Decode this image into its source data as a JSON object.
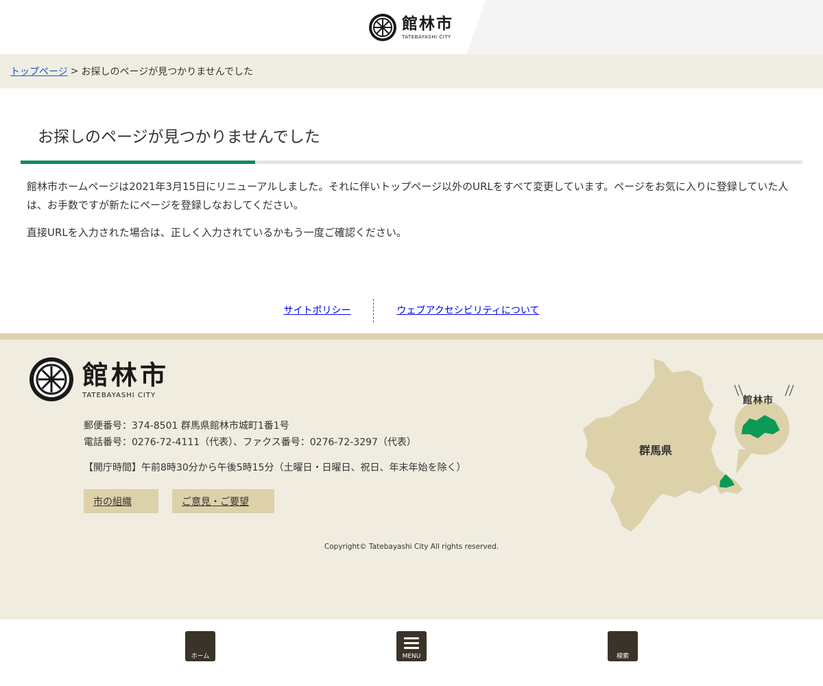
{
  "header": {
    "logo_name": "館林市",
    "logo_roman": "TATEBAYASHI CITY"
  },
  "breadcrumb": {
    "home": "トップページ",
    "separator": ">",
    "current": "お探しのページが見つかりませんでした"
  },
  "main": {
    "title": "お探しのページが見つかりませんでした",
    "paragraph1": "館林市ホームページは2021年3月15日にリニューアルしました。それに伴いトップページ以外のURLをすべて変更しています。ページをお気に入りに登録していた人は、お手数ですが新たにページを登録しなおしてください。",
    "paragraph2": "直接URLを入力された場合は、正しく入力されているかもう一度ご確認ください。",
    "accent_color": "#0e8a5a"
  },
  "footer_links": {
    "site_policy": "サイトポリシー",
    "accessibility": "ウェブアクセシビリティについて"
  },
  "footer": {
    "logo_name": "館林市",
    "logo_roman": "TATEBAYASHI CITY",
    "address": "郵便番号：374-8501 群馬県館林市城町1番1号",
    "phone": "電話番号：0276-72-4111（代表）、ファクス番号：0276-72-3297（代表）",
    "hours": "【開庁時間】午前8時30分から午後5時15分（土曜日・日曜日、祝日、年末年始を除く）",
    "btn_org": "市の組織",
    "btn_opinion": "ご意見・ご要望",
    "copyright": "Copyright© Tatebayashi City All rights reserved.",
    "map_pref_label": "群馬県",
    "map_city_label": "館林市",
    "background": "#f0ece0",
    "city_color": "#0a9a55"
  },
  "bottom_nav": {
    "home": "ホーム",
    "menu": "MENU",
    "search": "検索"
  }
}
